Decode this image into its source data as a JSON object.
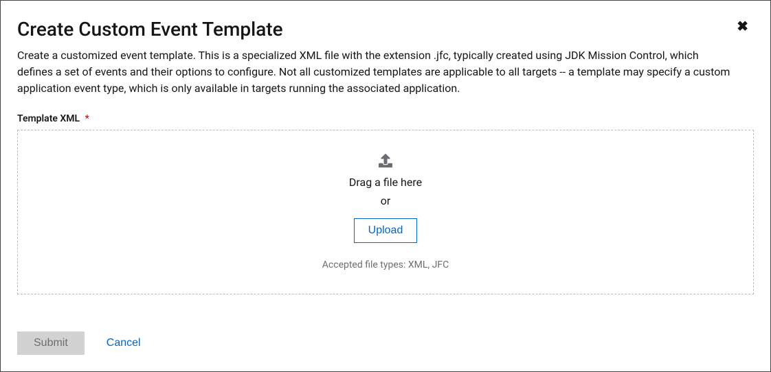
{
  "modal": {
    "title": "Create Custom Event Template",
    "description": "Create a customized event template. This is a specialized XML file with the extension .jfc, typically created using JDK Mission Control, which defines a set of events and their options to configure. Not all customized templates are applicable to all targets -- a template may specify a custom application event type, which is only available in targets running the associated application.",
    "close_label": "✖"
  },
  "form": {
    "field_label": "Template XML",
    "required_marker": "*"
  },
  "dropzone": {
    "drag_text": "Drag a file here",
    "or_text": "or",
    "upload_button_label": "Upload",
    "accepted_types": "Accepted file types: XML, JFC"
  },
  "footer": {
    "submit_label": "Submit",
    "cancel_label": "Cancel"
  }
}
